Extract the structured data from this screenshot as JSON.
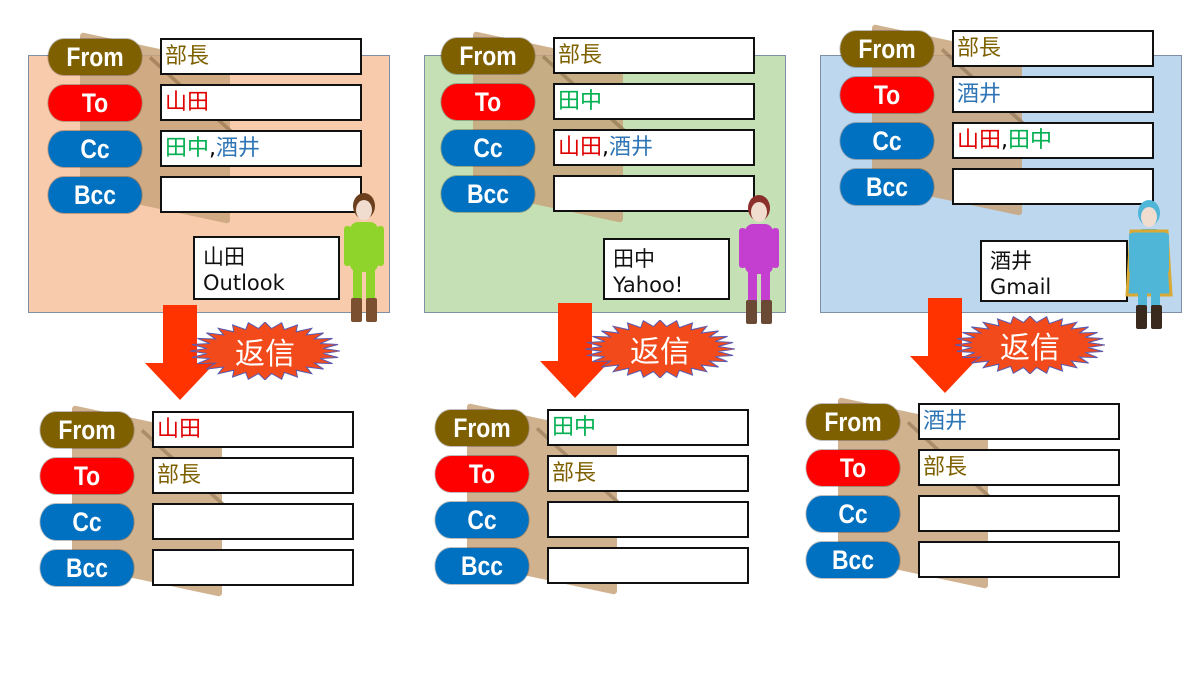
{
  "labels": {
    "from": "From",
    "to": "To",
    "cc": "Cc",
    "bcc": "Bcc"
  },
  "label_colors": {
    "from": "#7f6000",
    "to": "#ff0000",
    "cc": "#0070c0",
    "bcc": "#0070c0"
  },
  "reply_label": "返信",
  "arrow_color": "#ff3300",
  "people_colors": {
    "部長": "#7f6000",
    "山田": "#e00000",
    "田中": "#00b050",
    "酒井": "#2e75b6"
  },
  "columns": [
    {
      "panel_color": "#f8cbad",
      "user": {
        "name": "山田",
        "client": "Outlook",
        "avatar": "green-outfit-character"
      },
      "received": {
        "from": [
          {
            "t": "部長",
            "c": "#7f6000"
          }
        ],
        "to": [
          {
            "t": "山田",
            "c": "#e00000"
          }
        ],
        "cc": [
          {
            "t": "田中",
            "c": "#00b050"
          },
          {
            "t": ",",
            "c": "#000000"
          },
          {
            "t": "酒井",
            "c": "#2e75b6"
          }
        ],
        "bcc": []
      },
      "reply": {
        "from": [
          {
            "t": "山田",
            "c": "#e00000"
          }
        ],
        "to": [
          {
            "t": "部長",
            "c": "#7f6000"
          }
        ],
        "cc": [],
        "bcc": []
      }
    },
    {
      "panel_color": "#c5e0b4",
      "user": {
        "name": "田中",
        "client": "Yahoo!",
        "avatar": "purple-outfit-character"
      },
      "received": {
        "from": [
          {
            "t": "部長",
            "c": "#7f6000"
          }
        ],
        "to": [
          {
            "t": "田中",
            "c": "#00b050"
          }
        ],
        "cc": [
          {
            "t": "山田",
            "c": "#e00000"
          },
          {
            "t": ",",
            "c": "#000000"
          },
          {
            "t": "酒井",
            "c": "#2e75b6"
          }
        ],
        "bcc": []
      },
      "reply": {
        "from": [
          {
            "t": "田中",
            "c": "#00b050"
          }
        ],
        "to": [
          {
            "t": "部長",
            "c": "#7f6000"
          }
        ],
        "cc": [],
        "bcc": []
      }
    },
    {
      "panel_color": "#bdd7ee",
      "user": {
        "name": "酒井",
        "client": "Gmail",
        "avatar": "blue-mage-character"
      },
      "received": {
        "from": [
          {
            "t": "部長",
            "c": "#7f6000"
          }
        ],
        "to": [
          {
            "t": "酒井",
            "c": "#2e75b6"
          }
        ],
        "cc": [
          {
            "t": "山田",
            "c": "#e00000"
          },
          {
            "t": ",",
            "c": "#000000"
          },
          {
            "t": "田中",
            "c": "#00b050"
          }
        ],
        "bcc": []
      },
      "reply": {
        "from": [
          {
            "t": "酒井",
            "c": "#2e75b6"
          }
        ],
        "to": [
          {
            "t": "部長",
            "c": "#7f6000"
          }
        ],
        "cc": [],
        "bcc": []
      }
    }
  ]
}
